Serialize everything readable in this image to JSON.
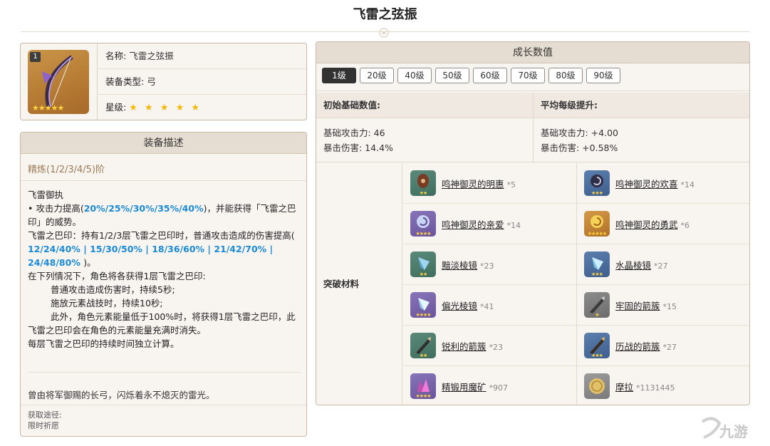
{
  "page": {
    "title": "飞雷之弦振"
  },
  "info": {
    "rank": "1",
    "name_label": "名称:",
    "name": "飞雷之弦振",
    "type_label": "装备类型:",
    "type": "弓",
    "star_label": "星级:",
    "stars": "★ ★ ★ ★ ★",
    "icon_stars": "★★★★★",
    "weapon_icon": "bow-icon"
  },
  "description": {
    "header": "装备描述",
    "refine": "精炼(1/2/3/4/5)阶",
    "skill_name": "飞雷御执",
    "line1_a": "• 攻击力提高(",
    "line1_b": "20%/25%/30%/35%/40%",
    "line1_c": ")，并能获得「飞雷之巴印」的威势。",
    "line2_a": "飞雷之巴印：持有1/2/3层飞雷之巴印时，普通攻击造成的伤害提高(",
    "line2_b": " 12/24/40% | 15/30/50% | 18/36/60% | 21/42/70% | 24/48/80% ",
    "line2_c": ")。",
    "line3": "在下列情况下，角色将各获得1层飞雷之巴印:",
    "line4": "普通攻击造成伤害时，持续5秒;",
    "line5": "施放元素战技时，持续10秒;",
    "line6": "此外，角色元素能量低于100%时，将获得1层飞雷之巴印，此飞雷之巴印会在角色的元素能量充满时消失。",
    "line7": "每层飞雷之巴印的持续时间独立计算。",
    "flavor": "曾由将军御赐的长弓，闪烁着永不熄灭的雷光。",
    "source_label": "获取途径:",
    "source": "限时祈愿"
  },
  "growth": {
    "header": "成长数值",
    "levels": [
      "1级",
      "20级",
      "40级",
      "50级",
      "60级",
      "70级",
      "80级",
      "90级"
    ],
    "base_header": "初始基础数值:",
    "avg_header": "平均每级提升:",
    "base_atk": "基础攻击力: 46",
    "base_crit": "暴击伤害: 14.4%",
    "avg_atk": "基础攻击力: +4.00",
    "avg_crit": "暴击伤害: +0.58%",
    "materials_label": "突破材料",
    "materials": [
      {
        "name": "鸣神御灵的明惠",
        "count": "*5",
        "icon": "tassel-icon",
        "stars": "★★"
      },
      {
        "name": "鸣神御灵的欢喜",
        "count": "*14",
        "icon": "spiral-icon",
        "stars": "★★★"
      },
      {
        "name": "鸣神御灵的亲爱",
        "count": "*14",
        "icon": "spiral-icon",
        "stars": "★★★★"
      },
      {
        "name": "鸣神御灵的勇武",
        "count": "*6",
        "icon": "spiral-gold-icon",
        "stars": "★★★★★"
      },
      {
        "name": "黯淡棱镜",
        "count": "*23",
        "icon": "prism-icon",
        "stars": "★★"
      },
      {
        "name": "水晶棱镜",
        "count": "*27",
        "icon": "prism-icon",
        "stars": "★★★"
      },
      {
        "name": "偏光棱镜",
        "count": "*41",
        "icon": "prism-icon",
        "stars": "★★★★"
      },
      {
        "name": "牢固的箭簇",
        "count": "*15",
        "icon": "arrowhead-icon",
        "stars": "★"
      },
      {
        "name": "锐利的箭簇",
        "count": "*23",
        "icon": "arrowhead-icon",
        "stars": "★★"
      },
      {
        "name": "历战的箭簇",
        "count": "*27",
        "icon": "arrowhead-icon",
        "stars": "★★★"
      },
      {
        "name": "精锻用魔矿",
        "count": "*907",
        "icon": "ore-icon",
        "stars": "★★★★"
      },
      {
        "name": "摩拉",
        "count": "*1131445",
        "icon": "mora-coin-icon",
        "stars": ""
      }
    ]
  },
  "watermark": {
    "text": "九游"
  }
}
